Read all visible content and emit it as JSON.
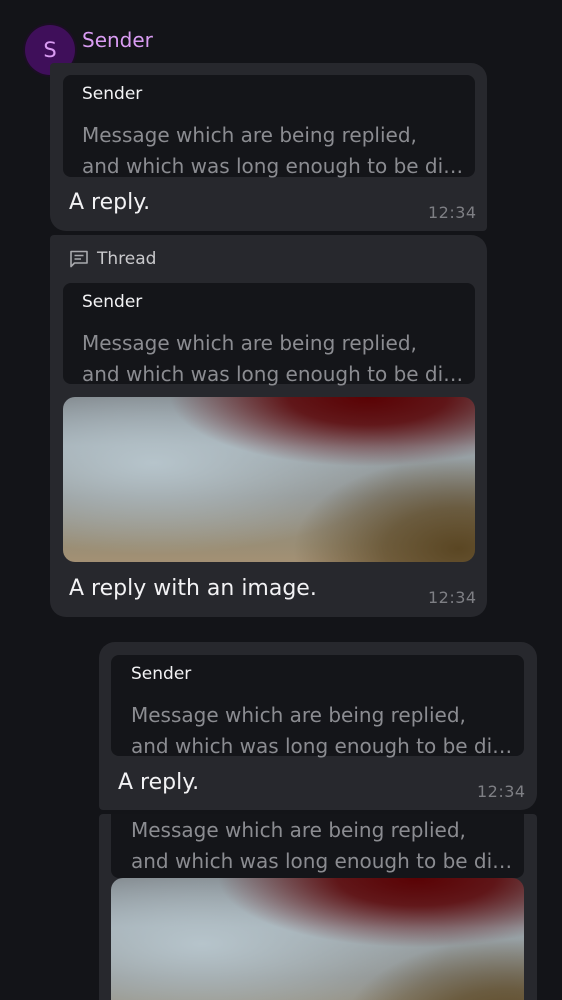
{
  "sender": {
    "avatar_letter": "S",
    "name": "Sender"
  },
  "messages": [
    {
      "quote_sender": "Sender",
      "quote_line1": "Message which are being replied,",
      "quote_line2": "and which was long enough to be di…",
      "text": "A reply.",
      "time": "12:34"
    },
    {
      "thread_label": "Thread",
      "quote_sender": "Sender",
      "quote_line1": "Message which are being replied,",
      "quote_line2": "and which was long enough to be di…",
      "text": "A reply with an image.",
      "time": "12:34"
    },
    {
      "quote_sender": "Sender",
      "quote_line1": "Message which are being replied,",
      "quote_line2": "and which was long enough to be di…",
      "text": "A reply.",
      "time": "12:34"
    },
    {
      "quote_line1": "Message which are being replied,",
      "quote_line2": "and which was long enough to be di…"
    }
  ],
  "colors": {
    "background": "#131418",
    "bubble": "#27282d",
    "quote_background": "#141519",
    "sender_name": "#d99cf2",
    "avatar_background": "#3f0f5a"
  }
}
